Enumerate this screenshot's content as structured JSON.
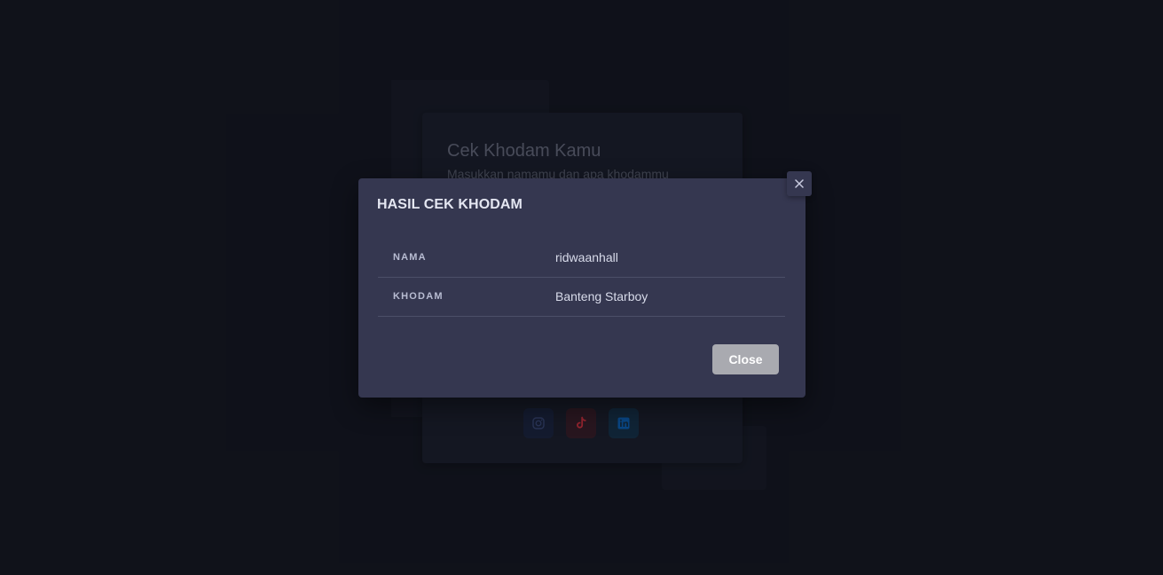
{
  "background": {
    "card_title": "Cek Khodam Kamu",
    "card_subtitle": "Masukkan namamu dan apa khodammu",
    "social_icons": [
      "instagram-icon",
      "tiktok-icon",
      "linkedin-icon"
    ]
  },
  "modal": {
    "title": "HASIL CEK KHODAM",
    "rows": [
      {
        "key": "NAMA",
        "value": "ridwaanhall"
      },
      {
        "key": "KHODAM",
        "value": "Banteng Starboy"
      }
    ],
    "close_label": "Close",
    "close_icon": "close-icon"
  },
  "colors": {
    "page_bg": "#13151f",
    "modal_bg": "#353750",
    "close_button_bg": "#a9aab0",
    "tiktok_accent": "#e0323f",
    "linkedin_accent": "#0a66c2",
    "instagram_accent": "#3b4a7a"
  }
}
